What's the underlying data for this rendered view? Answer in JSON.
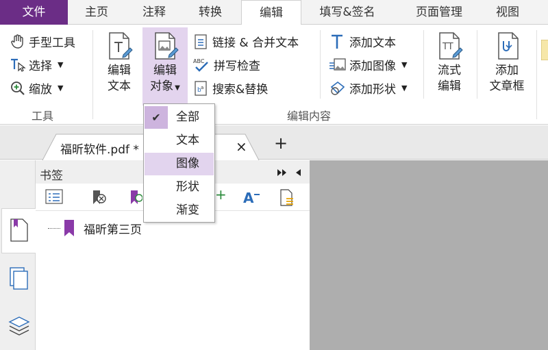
{
  "ribbon_tabs": [
    "文件",
    "主页",
    "注释",
    "转换",
    "编辑",
    "填写&签名",
    "页面管理",
    "视图"
  ],
  "tools_group": {
    "hand": "手型工具",
    "select": "选择",
    "zoom": "缩放",
    "label": "工具"
  },
  "edit_group": {
    "edit_text_line1": "编辑",
    "edit_text_line2": "文本",
    "edit_object_line1": "编辑",
    "edit_object_line2": "对象",
    "link_merge": "链接 & 合并文本",
    "spell_check": "拼写检查",
    "search_replace": "搜索&替换",
    "add_text": "添加文本",
    "add_image": "添加图像",
    "add_shape": "添加形状",
    "flow_edit_line1": "流式",
    "flow_edit_line2": "编辑",
    "add_article_line1": "添加",
    "add_article_line2": "文章框",
    "label": "编辑内容"
  },
  "doc_tab": {
    "title": "福昕软件.pdf *",
    "close": "×",
    "new": "+"
  },
  "panel": {
    "title": "书签",
    "bookmark": "福昕第三页"
  },
  "dropdown": {
    "items": [
      "全部",
      "文本",
      "图像",
      "形状",
      "渐变"
    ],
    "checked": "全部",
    "hovered": "图像",
    "check_mark": "✔"
  },
  "colors": {
    "accent": "#6b2d86",
    "selection": "#e3d4ee",
    "viewer_bg": "#aeaeae"
  }
}
